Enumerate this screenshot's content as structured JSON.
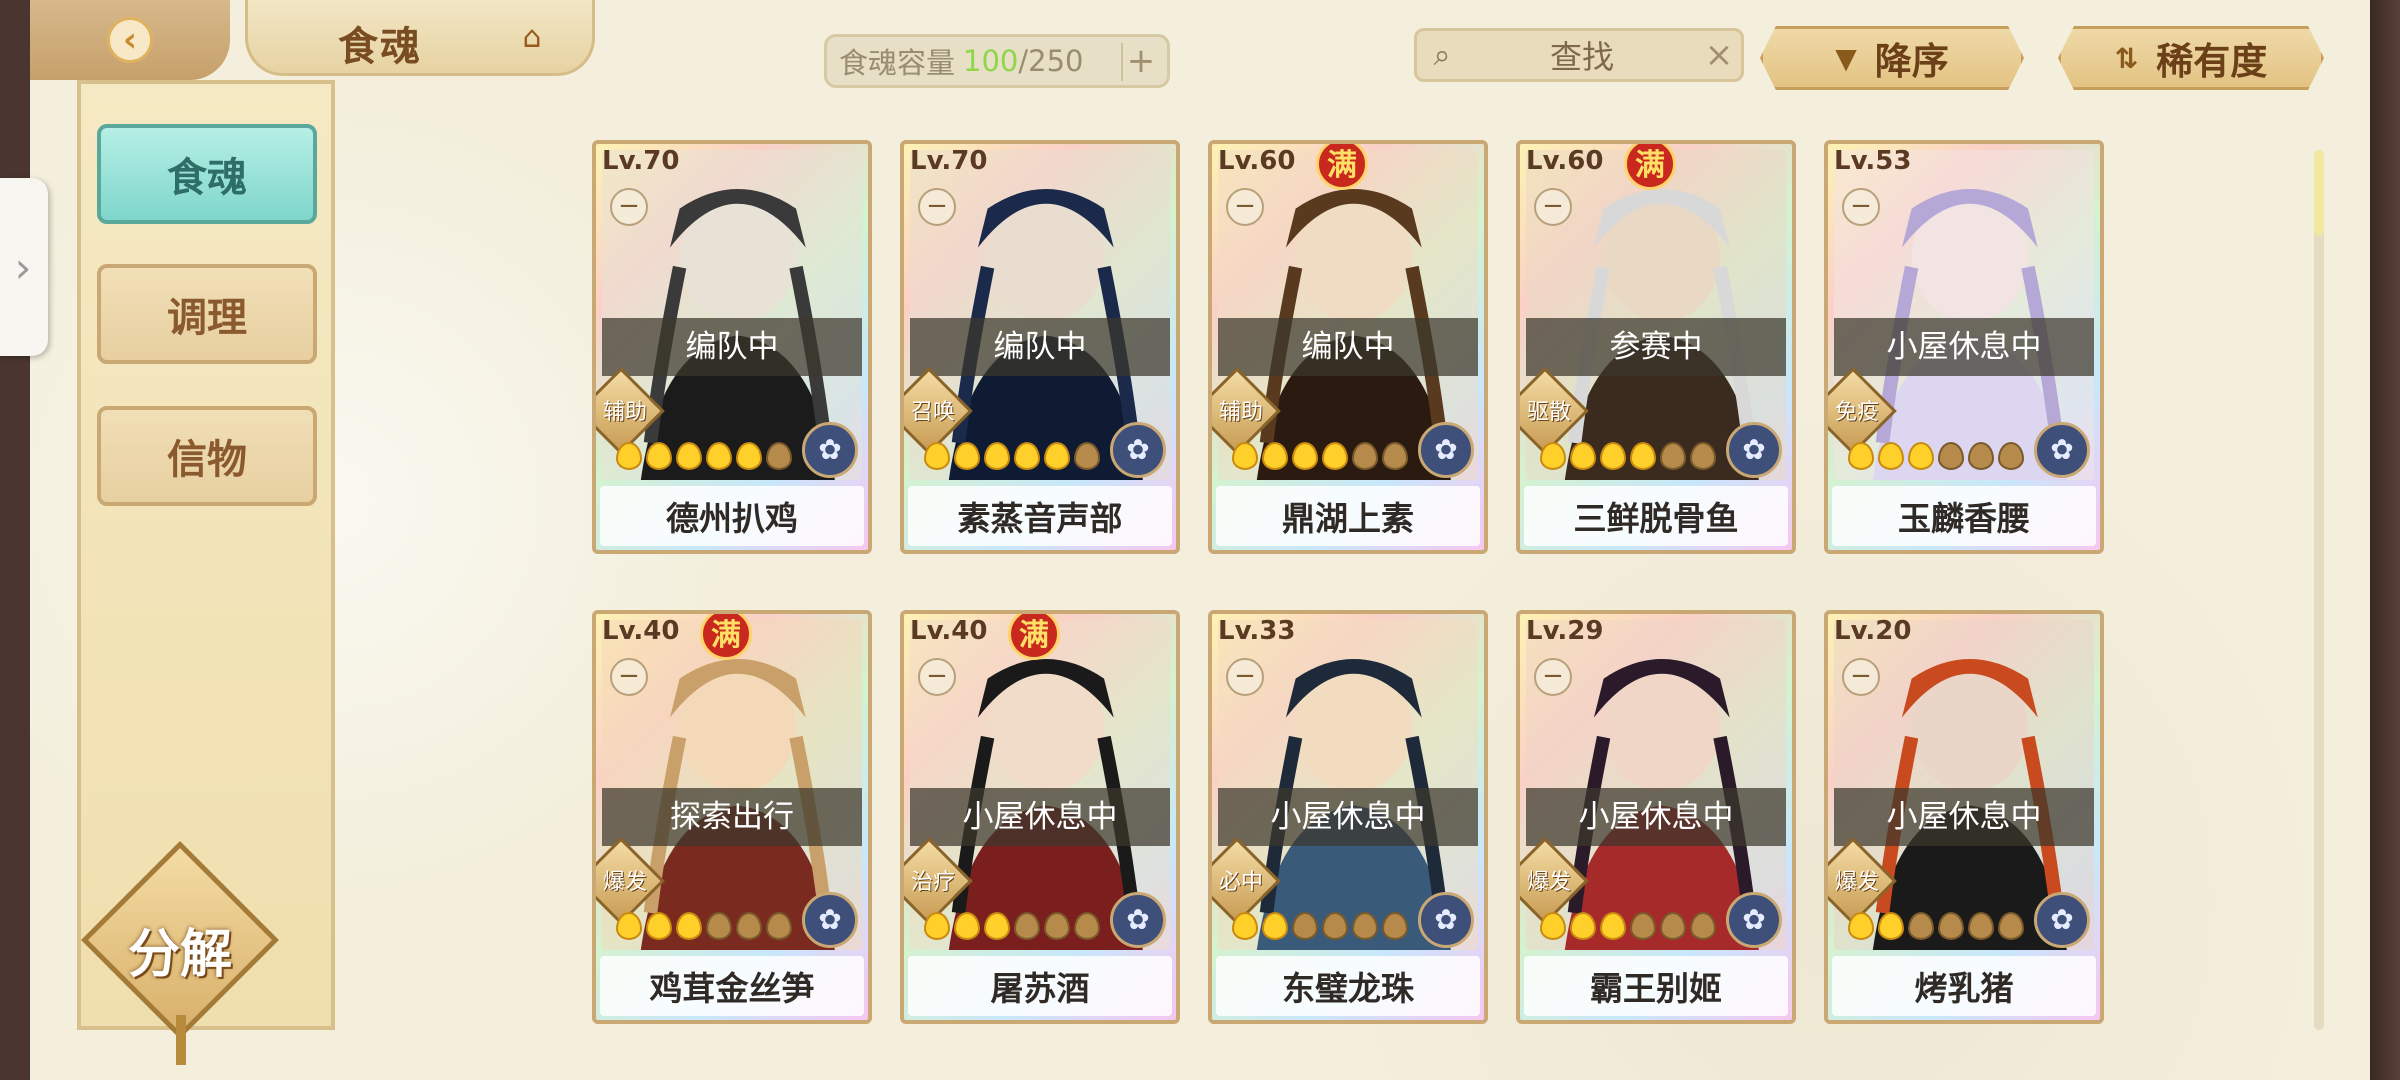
{
  "header": {
    "back_icon": "back-arrow-icon",
    "title": "食魂",
    "house_icon": "pavilion-icon",
    "capacity_label": "食魂容量",
    "capacity_current": "100",
    "capacity_sep": "/",
    "capacity_max": "250",
    "add_icon": "plus-icon",
    "search_label": "查找",
    "sort_desc_label": "降序",
    "sort_rarity_label": "稀有度",
    "accent_green": "#8fd64a"
  },
  "sidebar": {
    "items": [
      {
        "label": "食魂",
        "active": true
      },
      {
        "label": "调理",
        "active": false
      },
      {
        "label": "信物",
        "active": false
      }
    ],
    "decompose_label": "分解",
    "drawer_icon": "chevron-right-icon"
  },
  "cards": [
    {
      "level": "Lv.70",
      "full": false,
      "status": "编队中",
      "role": "辅助",
      "name": "德州扒鸡",
      "stars": 5
    },
    {
      "level": "Lv.70",
      "full": false,
      "status": "编队中",
      "role": "召唤",
      "name": "素蒸音声部",
      "stars": 5
    },
    {
      "level": "Lv.60",
      "full": true,
      "status": "编队中",
      "role": "辅助",
      "name": "鼎湖上素",
      "stars": 4
    },
    {
      "level": "Lv.60",
      "full": true,
      "status": "参赛中",
      "role": "驱散",
      "name": "三鲜脱骨鱼",
      "stars": 4
    },
    {
      "level": "Lv.53",
      "full": false,
      "status": "小屋休息中",
      "role": "免疫",
      "name": "玉麟香腰",
      "stars": 3
    },
    {
      "level": "Lv.40",
      "full": true,
      "status": "探索出行",
      "role": "爆发",
      "name": "鸡茸金丝笋",
      "stars": 3
    },
    {
      "level": "Lv.40",
      "full": true,
      "status": "小屋休息中",
      "role": "治疗",
      "name": "屠苏酒",
      "stars": 3
    },
    {
      "level": "Lv.33",
      "full": false,
      "status": "小屋休息中",
      "role": "必中",
      "name": "东璧龙珠",
      "stars": 2
    },
    {
      "level": "Lv.29",
      "full": false,
      "status": "小屋休息中",
      "role": "爆发",
      "name": "霸王别姬",
      "stars": 3
    },
    {
      "level": "Lv.20",
      "full": false,
      "status": "小屋休息中",
      "role": "爆发",
      "name": "烤乳猪",
      "stars": 2
    }
  ],
  "full_badge": "满"
}
